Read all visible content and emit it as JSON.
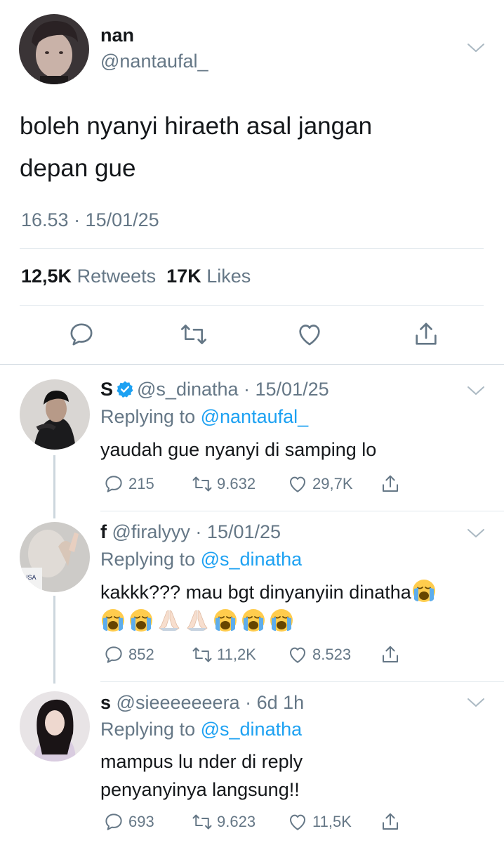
{
  "main_tweet": {
    "author_name": "nan",
    "author_handle": "@nantaufal_",
    "text_line1": "boleh nyanyi hiraeth asal jangan",
    "text_line2": "depan gue",
    "timestamp": "16.53 · 15/01/25",
    "retweet_count": "12,5K",
    "retweet_label": "Retweets",
    "like_count": "17K",
    "like_label": "Likes"
  },
  "replies": [
    {
      "name": "S",
      "verified": true,
      "meta": "@s_dinatha · 15/01/25",
      "replying_prefix": "Replying to",
      "replying_to": "@nantaufal_",
      "text_line1": "yaudah gue nyanyi di samping lo",
      "text_line2": "",
      "reply_count": "215",
      "retweet_count": "9.632",
      "like_count": "29,7K"
    },
    {
      "name": "f",
      "verified": false,
      "meta": "@firalyyy · 15/01/25",
      "replying_prefix": "Replying to",
      "replying_to": "@s_dinatha",
      "text_line1": "kakkk??? mau bgt dinyanyiin dinatha",
      "emojis": [
        "loudly-crying-face",
        "loudly-crying-face",
        "loudly-crying-face",
        "folded-hands",
        "folded-hands",
        "loudly-crying-face",
        "loudly-crying-face",
        "loudly-crying-face"
      ],
      "reply_count": "852",
      "retweet_count": "11,2K",
      "like_count": "8.523"
    },
    {
      "name": "s",
      "verified": false,
      "meta": "@sieeeeeeera · 6d 1h",
      "replying_prefix": "Replying to",
      "replying_to": "@s_dinatha",
      "text_line1": "mampus lu nder di reply",
      "text_line2": "penyanyinya langsung!!",
      "reply_count": "693",
      "retweet_count": "9.623",
      "like_count": "11,5K"
    }
  ],
  "icons": {
    "reply": "reply-icon",
    "retweet": "retweet-icon",
    "like": "heart-icon",
    "share": "share-icon",
    "more": "chevron-down-icon",
    "verified": "verified-badge-icon"
  },
  "colors": {
    "text": "#14171a",
    "secondary": "#657786",
    "accent": "#1da1f2",
    "divider": "#e1e8ed"
  }
}
